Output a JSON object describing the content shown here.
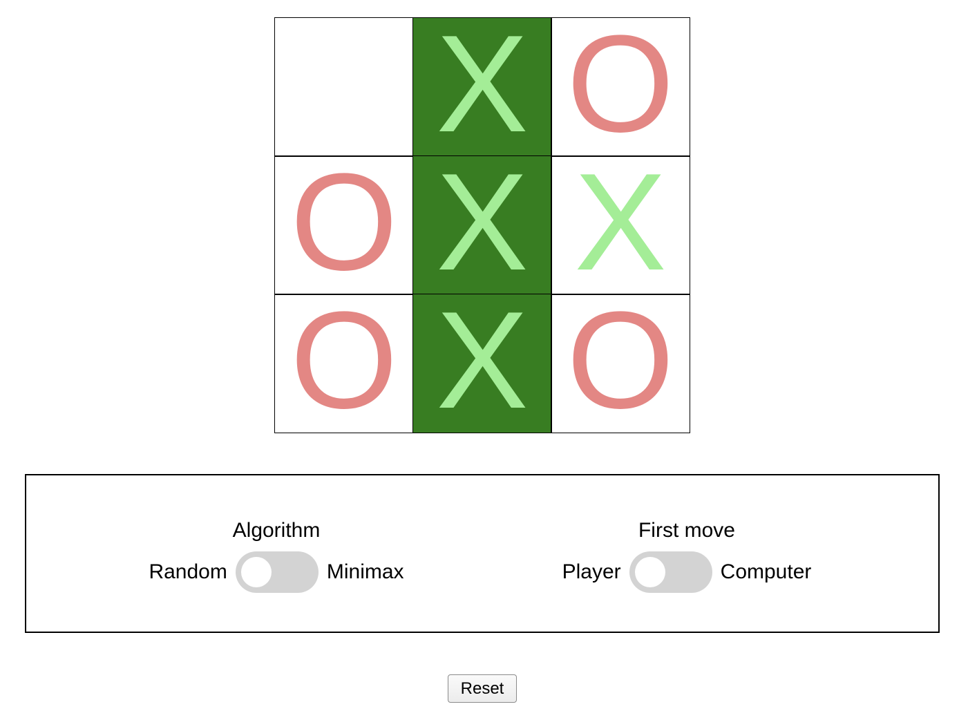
{
  "board": {
    "cells": [
      {
        "mark": "",
        "win": false
      },
      {
        "mark": "X",
        "win": true
      },
      {
        "mark": "O",
        "win": false
      },
      {
        "mark": "O",
        "win": false
      },
      {
        "mark": "X",
        "win": true
      },
      {
        "mark": "X",
        "win": false
      },
      {
        "mark": "O",
        "win": false
      },
      {
        "mark": "X",
        "win": true
      },
      {
        "mark": "O",
        "win": false
      }
    ],
    "colors": {
      "x": "#a4ed97",
      "o": "#e38784",
      "win_background": "#387d22"
    }
  },
  "settings": {
    "algorithm": {
      "title": "Algorithm",
      "left_label": "Random",
      "right_label": "Minimax",
      "selected": "Random"
    },
    "first_move": {
      "title": "First move",
      "left_label": "Player",
      "right_label": "Computer",
      "selected": "Player"
    },
    "switch_color": "#d3d3d3"
  },
  "reset_label": "Reset"
}
